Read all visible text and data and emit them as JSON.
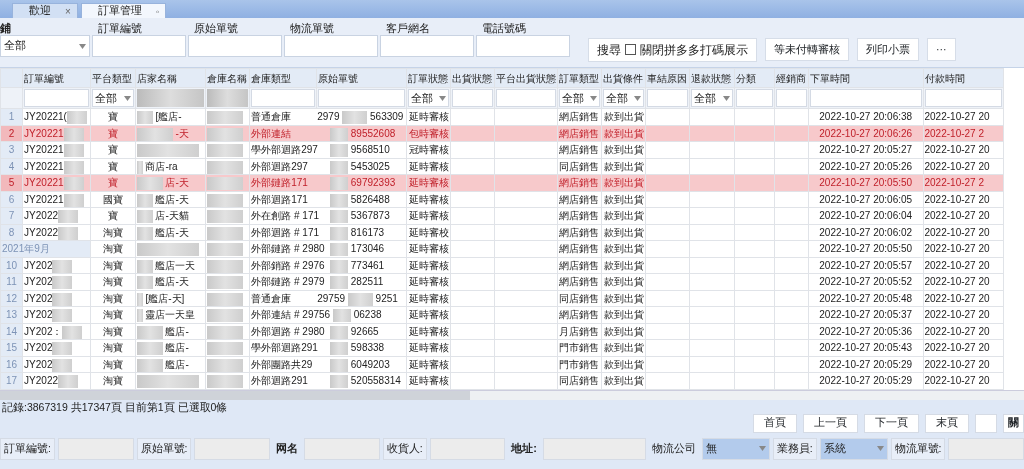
{
  "tabs": [
    {
      "label": "歡迎",
      "selected": false,
      "close": "×"
    },
    {
      "label": "訂單管理",
      "selected": true,
      "close": "◦"
    }
  ],
  "search_panel": {
    "fields": [
      {
        "label": "鋪",
        "kind": "select",
        "value": "全部"
      },
      {
        "label": "訂單編號",
        "kind": "text"
      },
      {
        "label": "原始單號",
        "kind": "text"
      },
      {
        "label": "物流單號",
        "kind": "text"
      },
      {
        "label": "客戶網名",
        "kind": "text"
      },
      {
        "label": "電話號碼",
        "kind": "text"
      }
    ],
    "search_label": "搜尋",
    "checkbox": {
      "label": "關閉拼多多打碼展示",
      "checked": false
    },
    "buttons": [
      "等未付轉審核",
      "列印小票",
      "···"
    ]
  },
  "columns": [
    {
      "label": "訂單編號",
      "kind": "text"
    },
    {
      "label": "平台類型",
      "kind": "select",
      "value": "全部"
    },
    {
      "label": "店家名稱",
      "kind": "blurred"
    },
    {
      "label": "倉庫名稱",
      "kind": "blurred"
    },
    {
      "label": "倉庫類型",
      "kind": "text"
    },
    {
      "label": "原始單號",
      "kind": "text"
    },
    {
      "label": "訂單狀態",
      "kind": "select",
      "value": "全部"
    },
    {
      "label": "出貨狀態",
      "kind": "text"
    },
    {
      "label": "平台出貨狀態",
      "kind": "text"
    },
    {
      "label": "訂單類型",
      "kind": "select",
      "value": "全部"
    },
    {
      "label": "出貨條件",
      "kind": "select",
      "value": "全部"
    },
    {
      "label": "車結原因",
      "kind": "text"
    },
    {
      "label": "退款狀態",
      "kind": "select",
      "value": "全部"
    },
    {
      "label": "分類",
      "kind": "text"
    },
    {
      "label": "經銷商",
      "kind": "text"
    },
    {
      "label": "下單時間",
      "kind": "text"
    },
    {
      "label": "付款時間",
      "kind": "text"
    }
  ],
  "rows": [
    {
      "no": "1",
      "order_no": "JY20221(",
      "platform": "寶",
      "shop": "[艦店-",
      "warehouse_type": "普通倉庫",
      "original_head": "2979",
      "original_tail": "563309",
      "status": "延時審核",
      "order_type": "網店銷售",
      "condition": "款到出貨",
      "order_time": "2022-10-27 20:06:38",
      "pay_time": "2022-10-27 20",
      "highlighted": false
    },
    {
      "no": "2",
      "order_no": "JY20221",
      "platform": "寶",
      "shop": "-天",
      "warehouse_type": "外部連結",
      "original_tail": "89552608",
      "status": "包時審核",
      "order_type": "網店銷售",
      "condition": "款到出貨",
      "order_time": "2022-10-27 20:06:26",
      "pay_time": "2022-10-27 2",
      "highlighted": true
    },
    {
      "no": "3",
      "order_no": "JY20221",
      "platform": "寶",
      "warehouse_type": "學外部迴路297",
      "original_tail": "9568510",
      "status": "冠時審核",
      "order_type": "網店銷售",
      "condition": "款到出貨",
      "order_time": "2022-10-27 20:05:27",
      "pay_time": "2022-10-27 20",
      "highlighted": false
    },
    {
      "no": "4",
      "order_no": "JY20221",
      "platform": "寶",
      "shop": "商店-ra",
      "warehouse_type": "外部迴路297",
      "original_tail": "5453025",
      "status": "延時審核",
      "order_type": "同店銷售",
      "condition": "款到出貨",
      "order_time": "2022-10-27 20:05:26",
      "pay_time": "2022-10-27 20",
      "highlighted": false
    },
    {
      "no": "5",
      "order_no": "JY20221",
      "platform": "寶",
      "shop": "店-天",
      "warehouse_type": "外部鏈路171",
      "original_tail": "69792393",
      "status": "延時審核",
      "order_type": "網店銷售",
      "condition": "款到出貨",
      "order_time": "2022-10-27 20:05:50",
      "pay_time": "2022-10-27 2",
      "highlighted": true
    },
    {
      "no": "6",
      "order_no": "JY20221",
      "platform": "國寶",
      "shop": "艦店-天",
      "warehouse_type": "外部迴路171",
      "original_tail": "5826488",
      "status": "延時審核",
      "order_type": "網店銷售",
      "condition": "款到出貨",
      "order_time": "2022-10-27 20:06:05",
      "pay_time": "2022-10-27 20",
      "highlighted": false
    },
    {
      "no": "7",
      "order_no": "JY2022",
      "platform": "寶",
      "shop": "店-天貓",
      "warehouse_type": "外在創路 # 171",
      "original_tail": "5367873",
      "status": "延時審核",
      "order_type": "網店銷售",
      "condition": "款到出貨",
      "order_time": "2022-10-27 20:06:04",
      "pay_time": "2022-10-27 20",
      "highlighted": false
    },
    {
      "no": "8",
      "order_no": "JY2022",
      "platform": "淘寶",
      "shop": "艦店-天",
      "warehouse_type": "外部迴路 # 171",
      "original_tail": "816173",
      "status": "延時審校",
      "order_type": "網店銷售",
      "condition": "款到出貨",
      "order_time": "2022-10-27 20:06:02",
      "pay_time": "2022-10-27 20",
      "highlighted": false
    },
    {
      "no": "2021年9月",
      "platform": "淘寶",
      "warehouse_type": "外部鏈路 # 2980",
      "original_tail": "173046",
      "status": "延時審核",
      "order_type": "網店銷售",
      "condition": "款到出貨",
      "order_time": "2022-10-27 20:05:50",
      "pay_time": "2022-10-27 20",
      "highlighted": false
    },
    {
      "no": "10",
      "order_no": "JY202",
      "platform": "淘寶",
      "shop": "艦店一天",
      "warehouse_type": "外部銷路 # 2976",
      "original_tail": "773461",
      "status": "延時審核",
      "order_type": "網店銷售",
      "condition": "款到出貨",
      "order_time": "2022-10-27 20:05:57",
      "pay_time": "2022-10-27 20",
      "highlighted": false
    },
    {
      "no": "11",
      "order_no": "JY202",
      "platform": "淘寶",
      "shop": "艦店-天",
      "warehouse_type": "外部鏈路 # 2979",
      "original_tail": "282511",
      "status": "延時審核",
      "order_type": "網店銷售",
      "condition": "款到出貨",
      "order_time": "2022-10-27 20:05:52",
      "pay_time": "2022-10-27 20",
      "highlighted": false
    },
    {
      "no": "12",
      "order_no": "JY202",
      "platform": "淘寶",
      "shop": "[艦店-天]",
      "warehouse_type": "普通倉庫",
      "original_head": "29759",
      "original_tail": "9251",
      "status": "延時審核",
      "order_type": "同店銷售",
      "condition": "款到出貨",
      "order_time": "2022-10-27 20:05:48",
      "pay_time": "2022-10-27 20",
      "highlighted": false
    },
    {
      "no": "13",
      "order_no": "JY202",
      "platform": "淘寶",
      "shop": "靈店一天皇",
      "warehouse_type": "外部連結 # 29756",
      "original_tail": "06238",
      "status": "延時審核",
      "order_type": "網店銷售",
      "condition": "款到出貨",
      "order_time": "2022-10-27 20:05:37",
      "pay_time": "2022-10-27 20",
      "highlighted": false
    },
    {
      "no": "14",
      "order_no": "JY202：",
      "platform": "淘寶",
      "shop": "艦店-",
      "warehouse_type": "外部迴路 # 2980",
      "original_tail": "92665",
      "status": "延時審核",
      "order_type": "月店銷售",
      "condition": "款到出貨",
      "order_time": "2022-10-27 20:05:36",
      "pay_time": "2022-10-27 20",
      "highlighted": false
    },
    {
      "no": "15",
      "order_no": "JY202",
      "platform": "淘寶",
      "shop": "艦店-",
      "warehouse_type": "學外部迴路291",
      "original_tail": "598338",
      "status": "延時審核",
      "order_type": "門市銷售",
      "condition": "款到出貨",
      "order_time": "2022-10-27 20:05:43",
      "pay_time": "2022-10-27 20",
      "highlighted": false
    },
    {
      "no": "16",
      "order_no": "JY202",
      "platform": "淘寶",
      "shop": "艦店-",
      "warehouse_type": "外部團路共29",
      "original_tail": "6049203",
      "status": "延時審核",
      "order_type": "門市銷售",
      "condition": "款到出貨",
      "order_time": "2022-10-27 20:05:29",
      "pay_time": "2022-10-27 20",
      "highlighted": false
    },
    {
      "no": "17",
      "order_no": "JY2022",
      "platform": "淘寶",
      "warehouse_type": "外部迴路291",
      "original_tail": "520558314",
      "status": "延時審核",
      "order_type": "同店銷售",
      "condition": "款到出貨",
      "order_time": "2022-10-27 20:05:29",
      "pay_time": "2022-10-27 20",
      "highlighted": false
    }
  ],
  "status_bar": "記錄:3867319 共17347頁 目前第1頁 已選取0條",
  "pager": [
    "首頁",
    "上一頁",
    "下一頁",
    "末頁"
  ],
  "pager_end": "關",
  "bottom_form": [
    {
      "label": "訂單編號:",
      "kind": "text"
    },
    {
      "label": "原始單號:",
      "kind": "text"
    },
    {
      "label": "网名",
      "kind": "text"
    },
    {
      "label": "收貨人:",
      "kind": "text"
    },
    {
      "label": "地址:",
      "kind": "text"
    },
    {
      "label": "物流公司",
      "kind": "select",
      "value": "無"
    },
    {
      "label": "業務員:",
      "kind": "select",
      "value": "系統"
    },
    {
      "label": "物流單號:",
      "kind": "text"
    }
  ]
}
